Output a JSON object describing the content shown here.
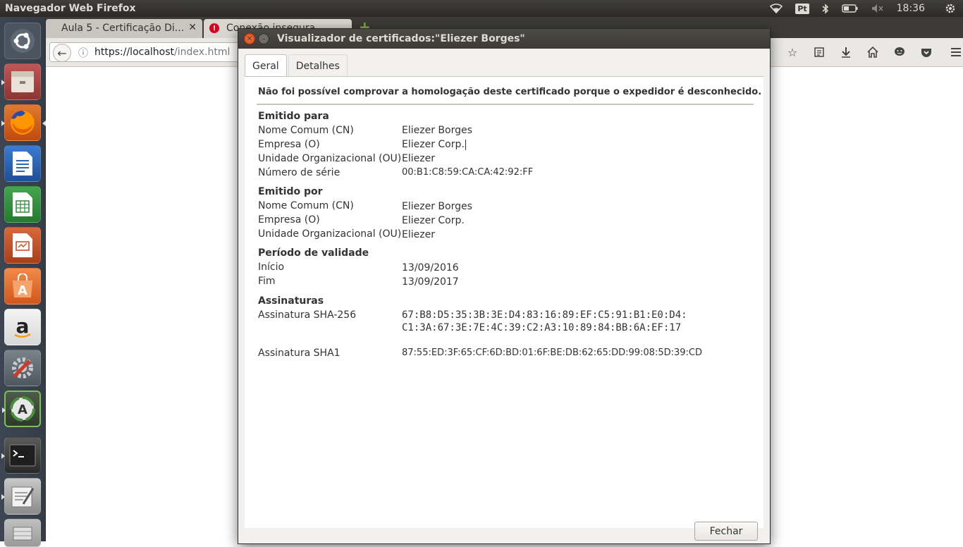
{
  "top_panel": {
    "app_title": "Navegador Web Firefox",
    "keyboard_layout": "Pt",
    "clock": "18:36"
  },
  "launcher": {
    "items": [
      {
        "name": "ubuntu-dash",
        "color": "#5a6470"
      },
      {
        "name": "files",
        "color": "#b24a4a"
      },
      {
        "name": "firefox",
        "color": "#e66000"
      },
      {
        "name": "libreoffice-writer",
        "color": "#2a6bb0"
      },
      {
        "name": "libreoffice-calc",
        "color": "#2e8b3a"
      },
      {
        "name": "libreoffice-impress",
        "color": "#c2542a"
      },
      {
        "name": "software-center",
        "color": "#e8743b"
      },
      {
        "name": "amazon",
        "color": "#ffffff"
      },
      {
        "name": "system-settings",
        "color": "#5b636b"
      },
      {
        "name": "software-updater",
        "color": "#4a8f3c"
      },
      {
        "name": "terminal",
        "color": "#2e2e2e"
      },
      {
        "name": "text-editor",
        "color": "#9a9a9a"
      }
    ]
  },
  "browser": {
    "tabs": [
      {
        "label": "Aula 5 - Certificação Di..."
      },
      {
        "label": "Conexão insegura"
      }
    ],
    "url_host": "https://localhost",
    "url_path": "/index.html"
  },
  "dialog": {
    "title": "Visualizador de certificados:\"Eliezer Borges\"",
    "tabs": [
      {
        "label": "Geral",
        "active": true
      },
      {
        "label": "Detalhes",
        "active": false
      }
    ],
    "warning": "Não foi possível comprovar a homologação deste certificado porque o expedidor é desconhecido.",
    "issued_to": {
      "title": "Emitido para",
      "rows": [
        {
          "label": "Nome Comum (CN)",
          "value": "Eliezer Borges"
        },
        {
          "label": "Empresa (O)",
          "value": "Eliezer Corp."
        },
        {
          "label": "Unidade Organizacional (OU)",
          "value": "Eliezer"
        },
        {
          "label": "Número de série",
          "value": "00:B1:C8:59:CA:CA:42:92:FF"
        }
      ]
    },
    "issued_by": {
      "title": "Emitido por",
      "rows": [
        {
          "label": "Nome Comum (CN)",
          "value": "Eliezer Borges"
        },
        {
          "label": "Empresa (O)",
          "value": "Eliezer Corp."
        },
        {
          "label": "Unidade Organizacional (OU)",
          "value": "Eliezer"
        }
      ]
    },
    "validity": {
      "title": "Período de validade",
      "rows": [
        {
          "label": "Início",
          "value": "13/09/2016"
        },
        {
          "label": "Fim",
          "value": "13/09/2017"
        }
      ]
    },
    "signatures": {
      "title": "Assinaturas",
      "sha256_label": "Assinatura SHA-256",
      "sha256_line1": "67:B8:D5:35:3B:3E:D4:83:16:89:EF:C5:91:B1:E0:D4:",
      "sha256_line2": "C1:3A:67:3E:7E:4C:39:C2:A3:10:89:84:BB:6A:EF:17",
      "sha1_label": "Assinatura SHA1",
      "sha1_value": "87:55:ED:3F:65:CF:6D:BD:01:6F:BE:DB:62:65:DD:99:08:5D:39:CD"
    },
    "close_button": "Fechar"
  }
}
